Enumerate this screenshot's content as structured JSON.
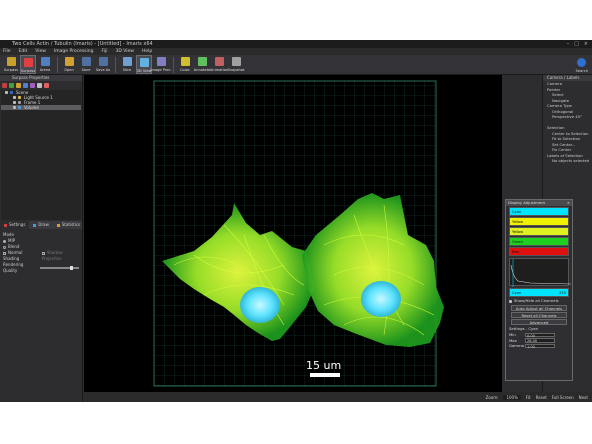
{
  "window": {
    "title": "Two Cells Actin / Tubulin (Imaris) - [Untitled] - Imaris x64",
    "controls": [
      "–",
      "□",
      "×"
    ]
  },
  "menu": [
    "File",
    "Edit",
    "View",
    "Image Processing",
    "Fiji",
    "3D View",
    "Help"
  ],
  "toolbar": {
    "buttons": [
      {
        "label": "Surpass",
        "color": "#c8a030",
        "active": false
      },
      {
        "label": "Surpass",
        "color": "#e04040",
        "active": true
      },
      {
        "label": "Arena",
        "color": "#5080c0",
        "active": false
      },
      {
        "label": "Open",
        "color": "#d0a030",
        "active": false
      },
      {
        "label": "Save",
        "color": "#5070a0",
        "active": false
      },
      {
        "label": "Save As",
        "color": "#5070a0",
        "active": false
      },
      {
        "label": "Slice",
        "color": "#70a0d0",
        "active": false
      },
      {
        "label": "3D View",
        "color": "#60b0e0",
        "active": true
      },
      {
        "label": "Image Proc.",
        "color": "#8080c0",
        "active": false
      },
      {
        "label": "Coloc",
        "color": "#d0c030",
        "active": false
      },
      {
        "label": "Annotate",
        "color": "#60c060",
        "active": false
      },
      {
        "label": "Animation",
        "color": "#c06060",
        "active": false
      },
      {
        "label": "Snapshot",
        "color": "#a0a0a0",
        "active": false
      }
    ],
    "right_label": "Search"
  },
  "left_panel": {
    "title": "Surpass Properties",
    "tree": [
      {
        "label": "Scene",
        "color": "#3070d0",
        "selected": false,
        "indent": 0
      },
      {
        "label": "Light Source 1",
        "color": "#e0c040",
        "selected": false,
        "indent": 1
      },
      {
        "label": "Frame 1",
        "color": "#a0a0a0",
        "selected": false,
        "indent": 1
      },
      {
        "label": "Volume",
        "color": "#50a0e0",
        "selected": true,
        "indent": 1
      }
    ],
    "tabs": [
      "Settings",
      "Draw",
      "Statistics"
    ],
    "mode_label": "Mode",
    "modes": [
      {
        "label": "MIP",
        "checked": true
      },
      {
        "label": "Blend",
        "checked": false
      },
      {
        "label": "Normal Shading",
        "checked": false
      },
      {
        "label": "Shadow Projection",
        "checked": false
      }
    ],
    "rendering_quality_label": "Rendering Quality"
  },
  "viewport": {
    "scale_bar_label": "15 um"
  },
  "right_panel": {
    "title": "Camera / Labels",
    "lines": [
      {
        "text": "Camera",
        "ind": false
      },
      {
        "text": "Pointer",
        "ind": false
      },
      {
        "text": "Select",
        "ind": true
      },
      {
        "text": "Navigate",
        "ind": true
      },
      {
        "text": "Camera Type",
        "ind": false
      },
      {
        "text": "Orthogonal",
        "ind": true
      },
      {
        "text": "Perspective 45°",
        "ind": true
      },
      {
        "text": "",
        "ind": false
      },
      {
        "text": "Selection",
        "ind": false
      },
      {
        "text": "Center to Selection",
        "ind": true
      },
      {
        "text": "Fit to Selection",
        "ind": true
      },
      {
        "text": "Set Center...",
        "ind": true
      },
      {
        "text": "Fix Center",
        "ind": true
      },
      {
        "text": "Labels of Selection",
        "ind": false
      },
      {
        "text": "No objects selected",
        "ind": true
      }
    ]
  },
  "display_adjustment": {
    "title": "Display Adjustment",
    "channels": [
      {
        "name": "Cyan",
        "color": "#00e5ff"
      },
      {
        "name": "Yellow",
        "color": "#f0f000"
      },
      {
        "name": "Yellow",
        "color": "#e0f020"
      },
      {
        "name": "Green",
        "color": "#20d020"
      },
      {
        "name": "Red",
        "color": "#e01010"
      }
    ],
    "selected_channel": "Cyan",
    "selected_max": "255",
    "show_hide_all": "Show/Hide all Channels",
    "buttons": [
      "Auto Adjust all Channels",
      "Reset all Channels",
      "Advanced"
    ],
    "settings_label": "Settings - Cyan",
    "fields": [
      {
        "label": "Min",
        "value": "0.00"
      },
      {
        "label": "Max",
        "value": "28.00"
      },
      {
        "label": "Gamma",
        "value": "1.00"
      }
    ]
  },
  "status": {
    "zoom": "Zoom:",
    "zoom_value": "100%",
    "items": [
      "Fit",
      "Reset",
      "Full Screen",
      "Next"
    ]
  }
}
